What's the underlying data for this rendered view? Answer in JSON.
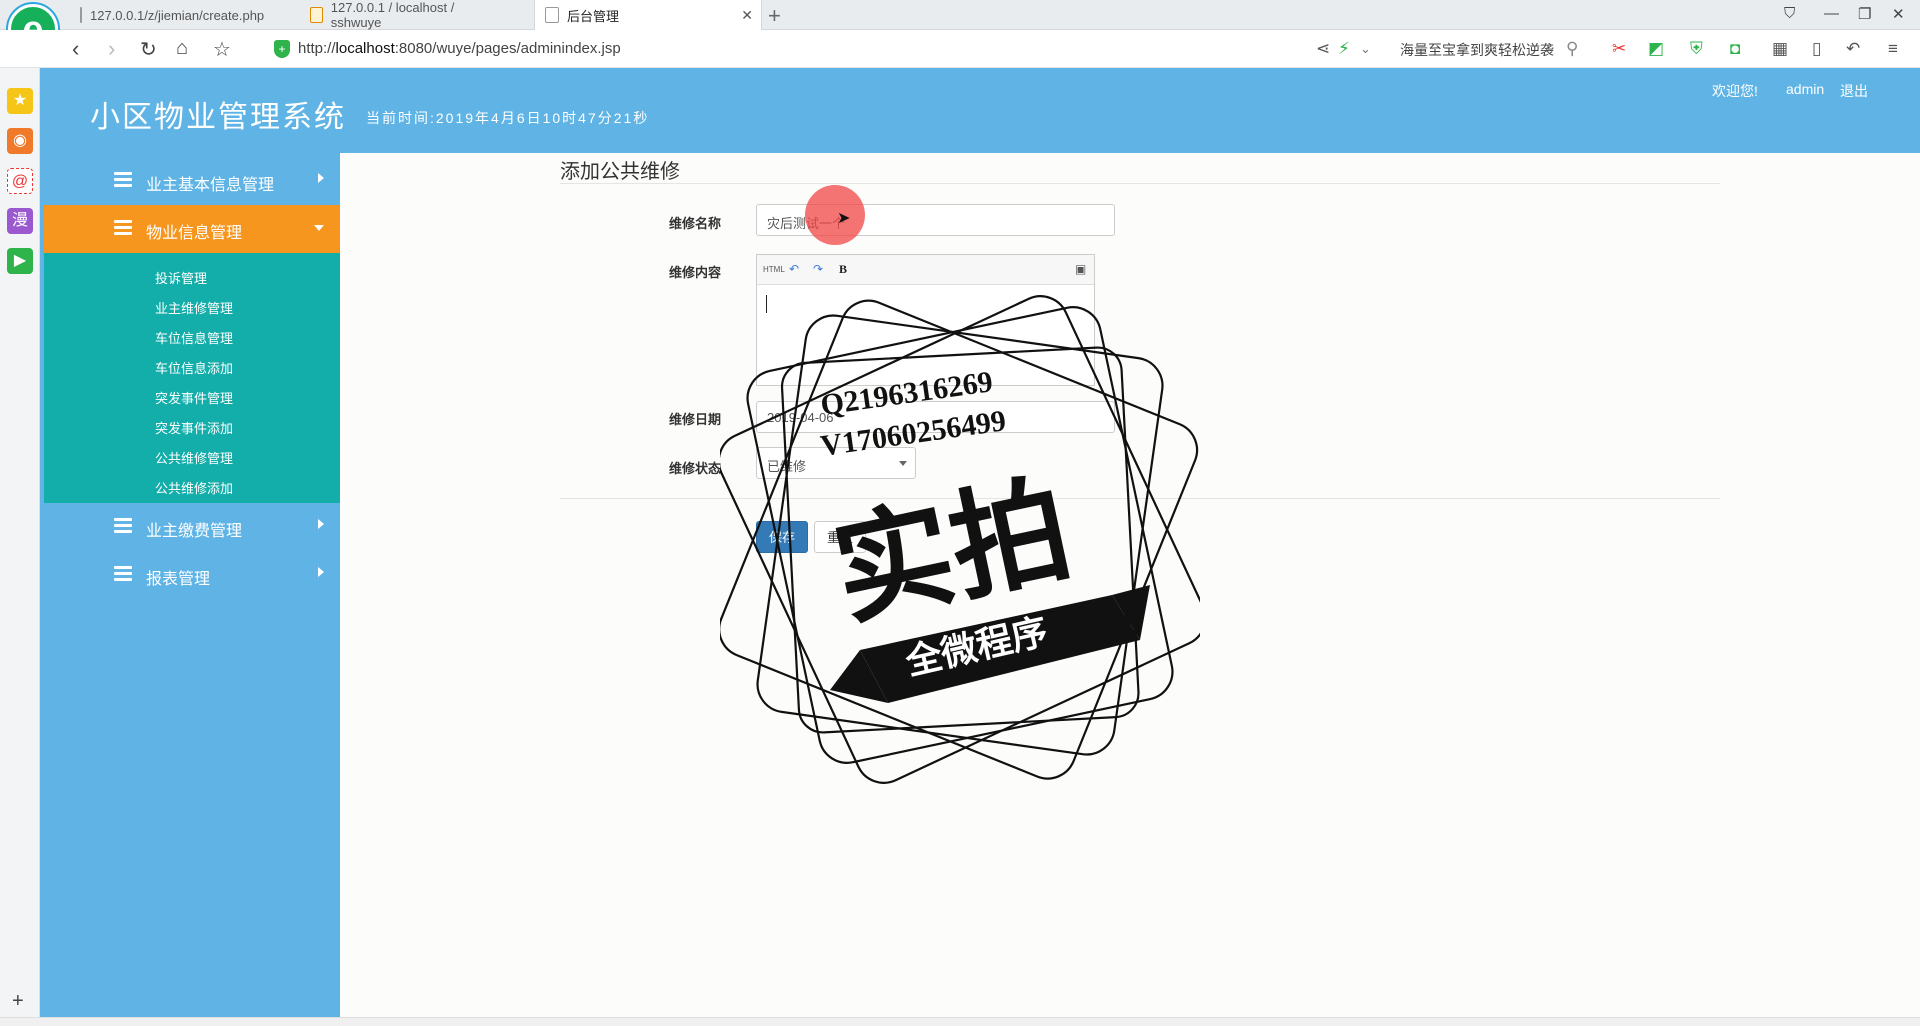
{
  "browser": {
    "tabs": [
      {
        "label": "127.0.0.1/z/jiemian/create.php"
      },
      {
        "label": "127.0.0.1 / localhost / sshwuye"
      },
      {
        "label": "后台管理"
      }
    ],
    "url_prefix": "http://",
    "url_host": "localhost",
    "url_rest": ":8080/wuye/pages/adminindex.jsp",
    "search_hint": "海量至宝拿到爽轻松逆袭",
    "logo_letter": "e"
  },
  "header": {
    "title": "小区物业管理系统",
    "time": "当前时间:2019年4月6日10时47分21秒",
    "welcome": "欢迎您!",
    "user": "admin",
    "logout": "退出"
  },
  "sidebar": {
    "menus": [
      {
        "label": "业主基本信息管理"
      },
      {
        "label": "物业信息管理"
      },
      {
        "label": "业主缴费管理"
      },
      {
        "label": "报表管理"
      }
    ],
    "submenu": [
      {
        "label": "投诉管理"
      },
      {
        "label": "业主维修管理"
      },
      {
        "label": "车位信息管理"
      },
      {
        "label": "车位信息添加"
      },
      {
        "label": "突发事件管理"
      },
      {
        "label": "突发事件添加"
      },
      {
        "label": "公共维修管理"
      },
      {
        "label": "公共维修添加"
      }
    ]
  },
  "form": {
    "heading": "添加公共维修",
    "name_label": "维修名称",
    "name_value": "灾后测试一个",
    "content_label": "维修内容",
    "editor_buttons": {
      "html": "HTML",
      "bold": "B"
    },
    "date_label": "维修日期",
    "date_value": "2019-04-06",
    "status_label": "维修状态",
    "status_value": "已维修",
    "save": "保存",
    "reset": "重置"
  },
  "watermark": {
    "line1": "Q2196316269",
    "line2": "V17060256499",
    "big": "实拍",
    "banner": "全微程序"
  },
  "icons": [
    "star-icon",
    "weibo-icon",
    "mail-icon",
    "comic-icon",
    "video-icon",
    "plus-icon",
    "shield-icon",
    "back-icon",
    "forward-icon",
    "refresh-icon",
    "home-icon",
    "favorite-icon"
  ]
}
